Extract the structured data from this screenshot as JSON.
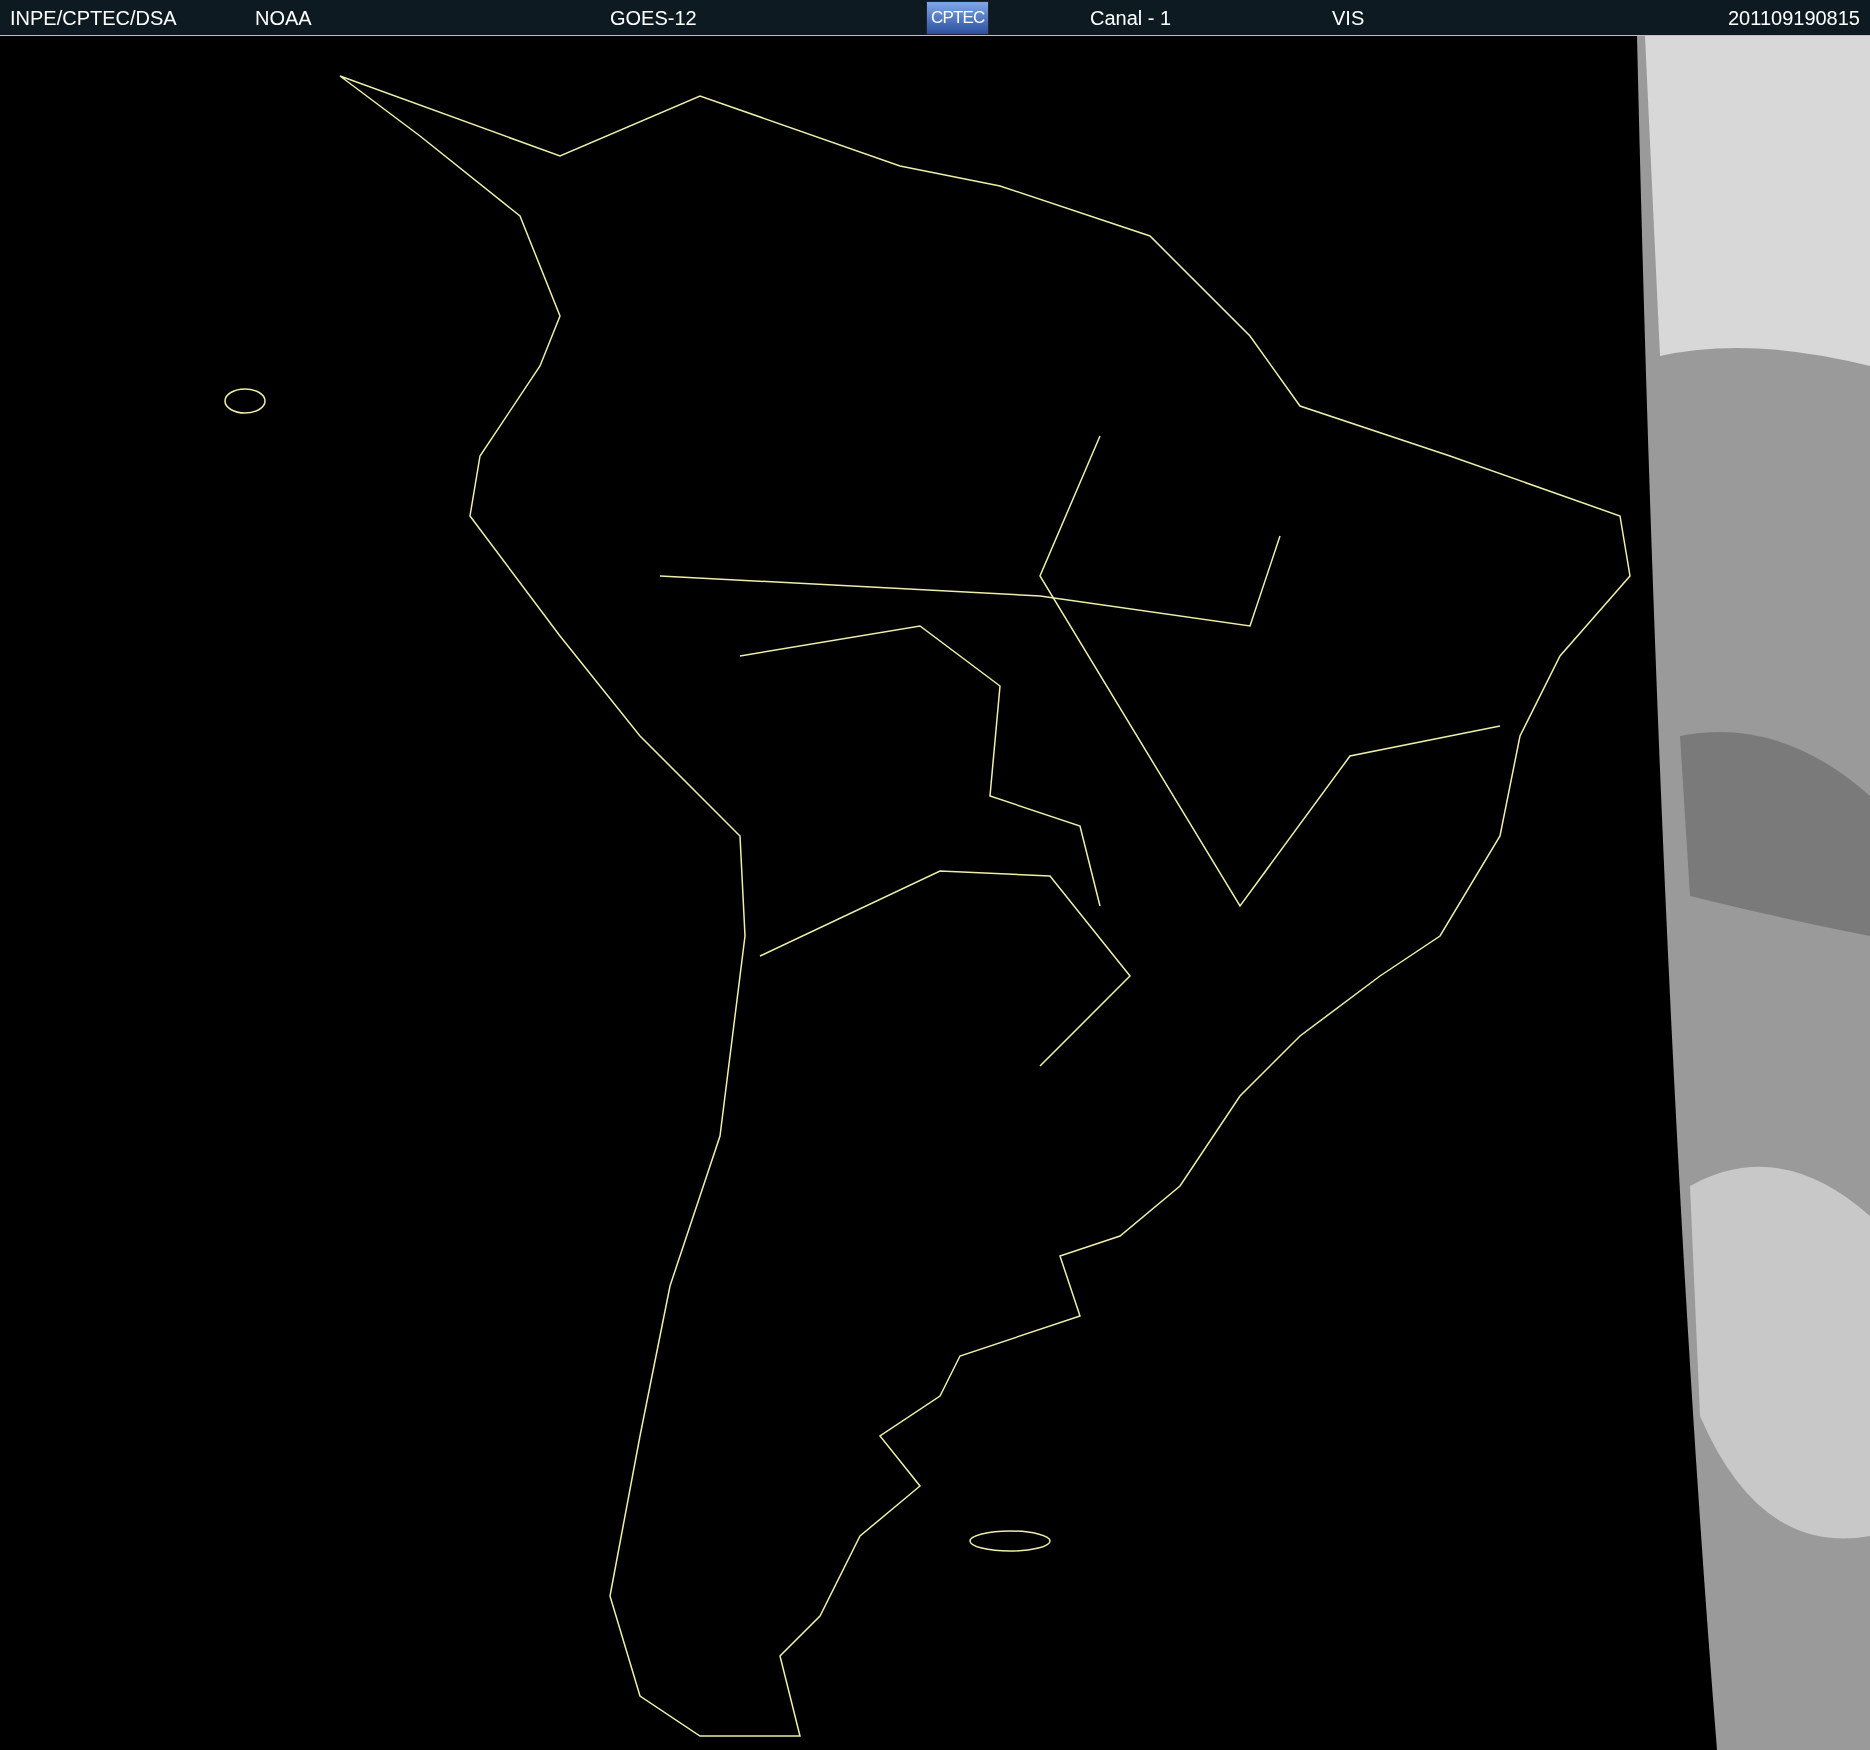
{
  "header": {
    "items": [
      {
        "kind": "text",
        "text": "INPE/CPTEC/DSA"
      },
      {
        "kind": "text",
        "text": "NOAA"
      },
      {
        "kind": "text",
        "text": "GOES-12"
      },
      {
        "kind": "logo",
        "text": "CPTEC"
      },
      {
        "kind": "text",
        "text": "Canal - 1"
      },
      {
        "kind": "text",
        "text": "VIS"
      },
      {
        "kind": "text",
        "text": "201109190815"
      }
    ]
  }
}
